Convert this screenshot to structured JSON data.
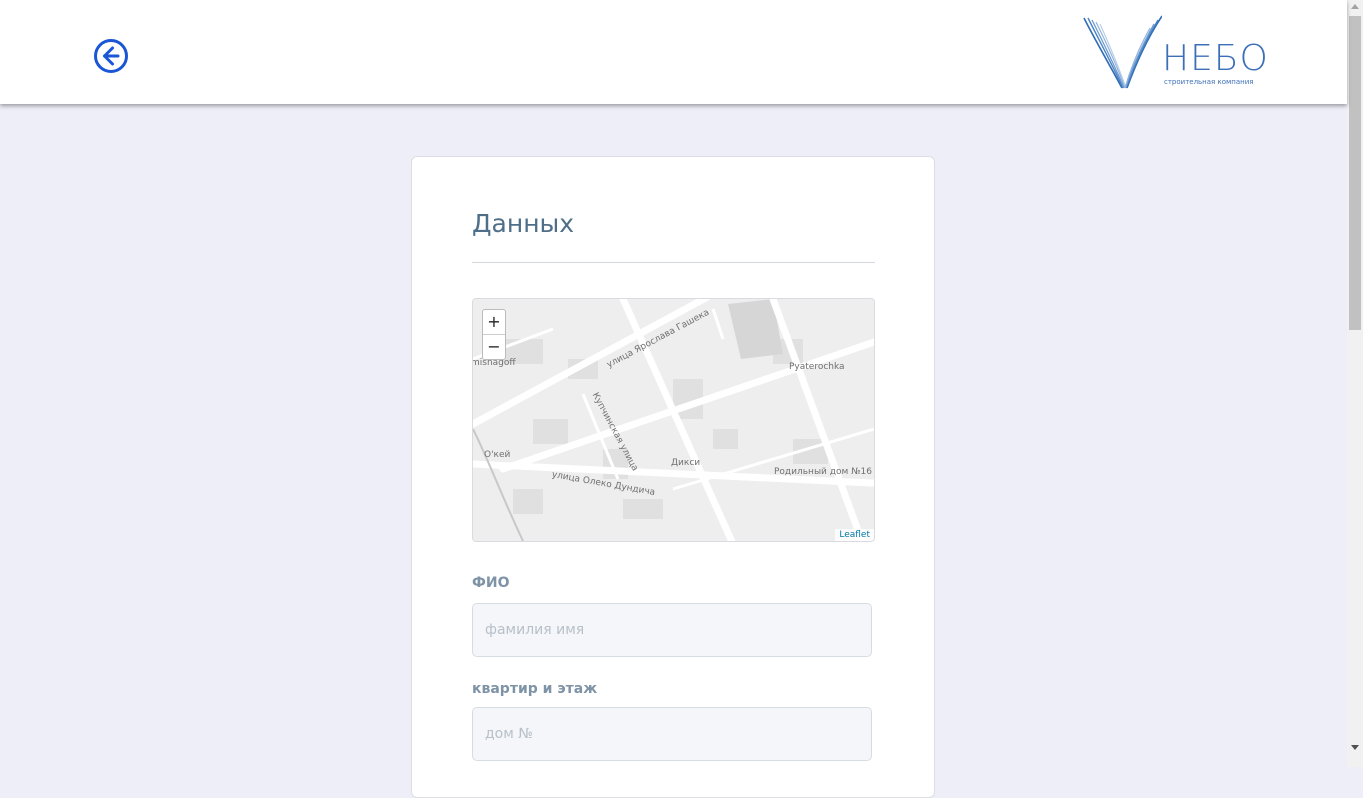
{
  "header": {
    "logo_text": "НЕБО",
    "logo_subtitle": "строительная компания"
  },
  "form": {
    "title": "Данных",
    "map": {
      "streets": [
        "улица Ярослава Гашека",
        "Купчинская улица",
        "улица Олеко Дундича"
      ],
      "places": [
        "Pyaterochka",
        "Дикси",
        "О'кей",
        "Родильный дом №16",
        "misnagoff"
      ],
      "zoom_in": "+",
      "zoom_out": "−",
      "attribution": "Leaflet"
    },
    "fields": [
      {
        "label": "ФИО",
        "placeholder": "фамилия имя",
        "value": ""
      },
      {
        "label": "квартир и этаж",
        "placeholder": "дом №",
        "value": ""
      }
    ]
  },
  "colors": {
    "background": "#edeef7",
    "accent": "#1a56d6",
    "logo": "#3c6fb8",
    "title": "#4f6f88"
  }
}
